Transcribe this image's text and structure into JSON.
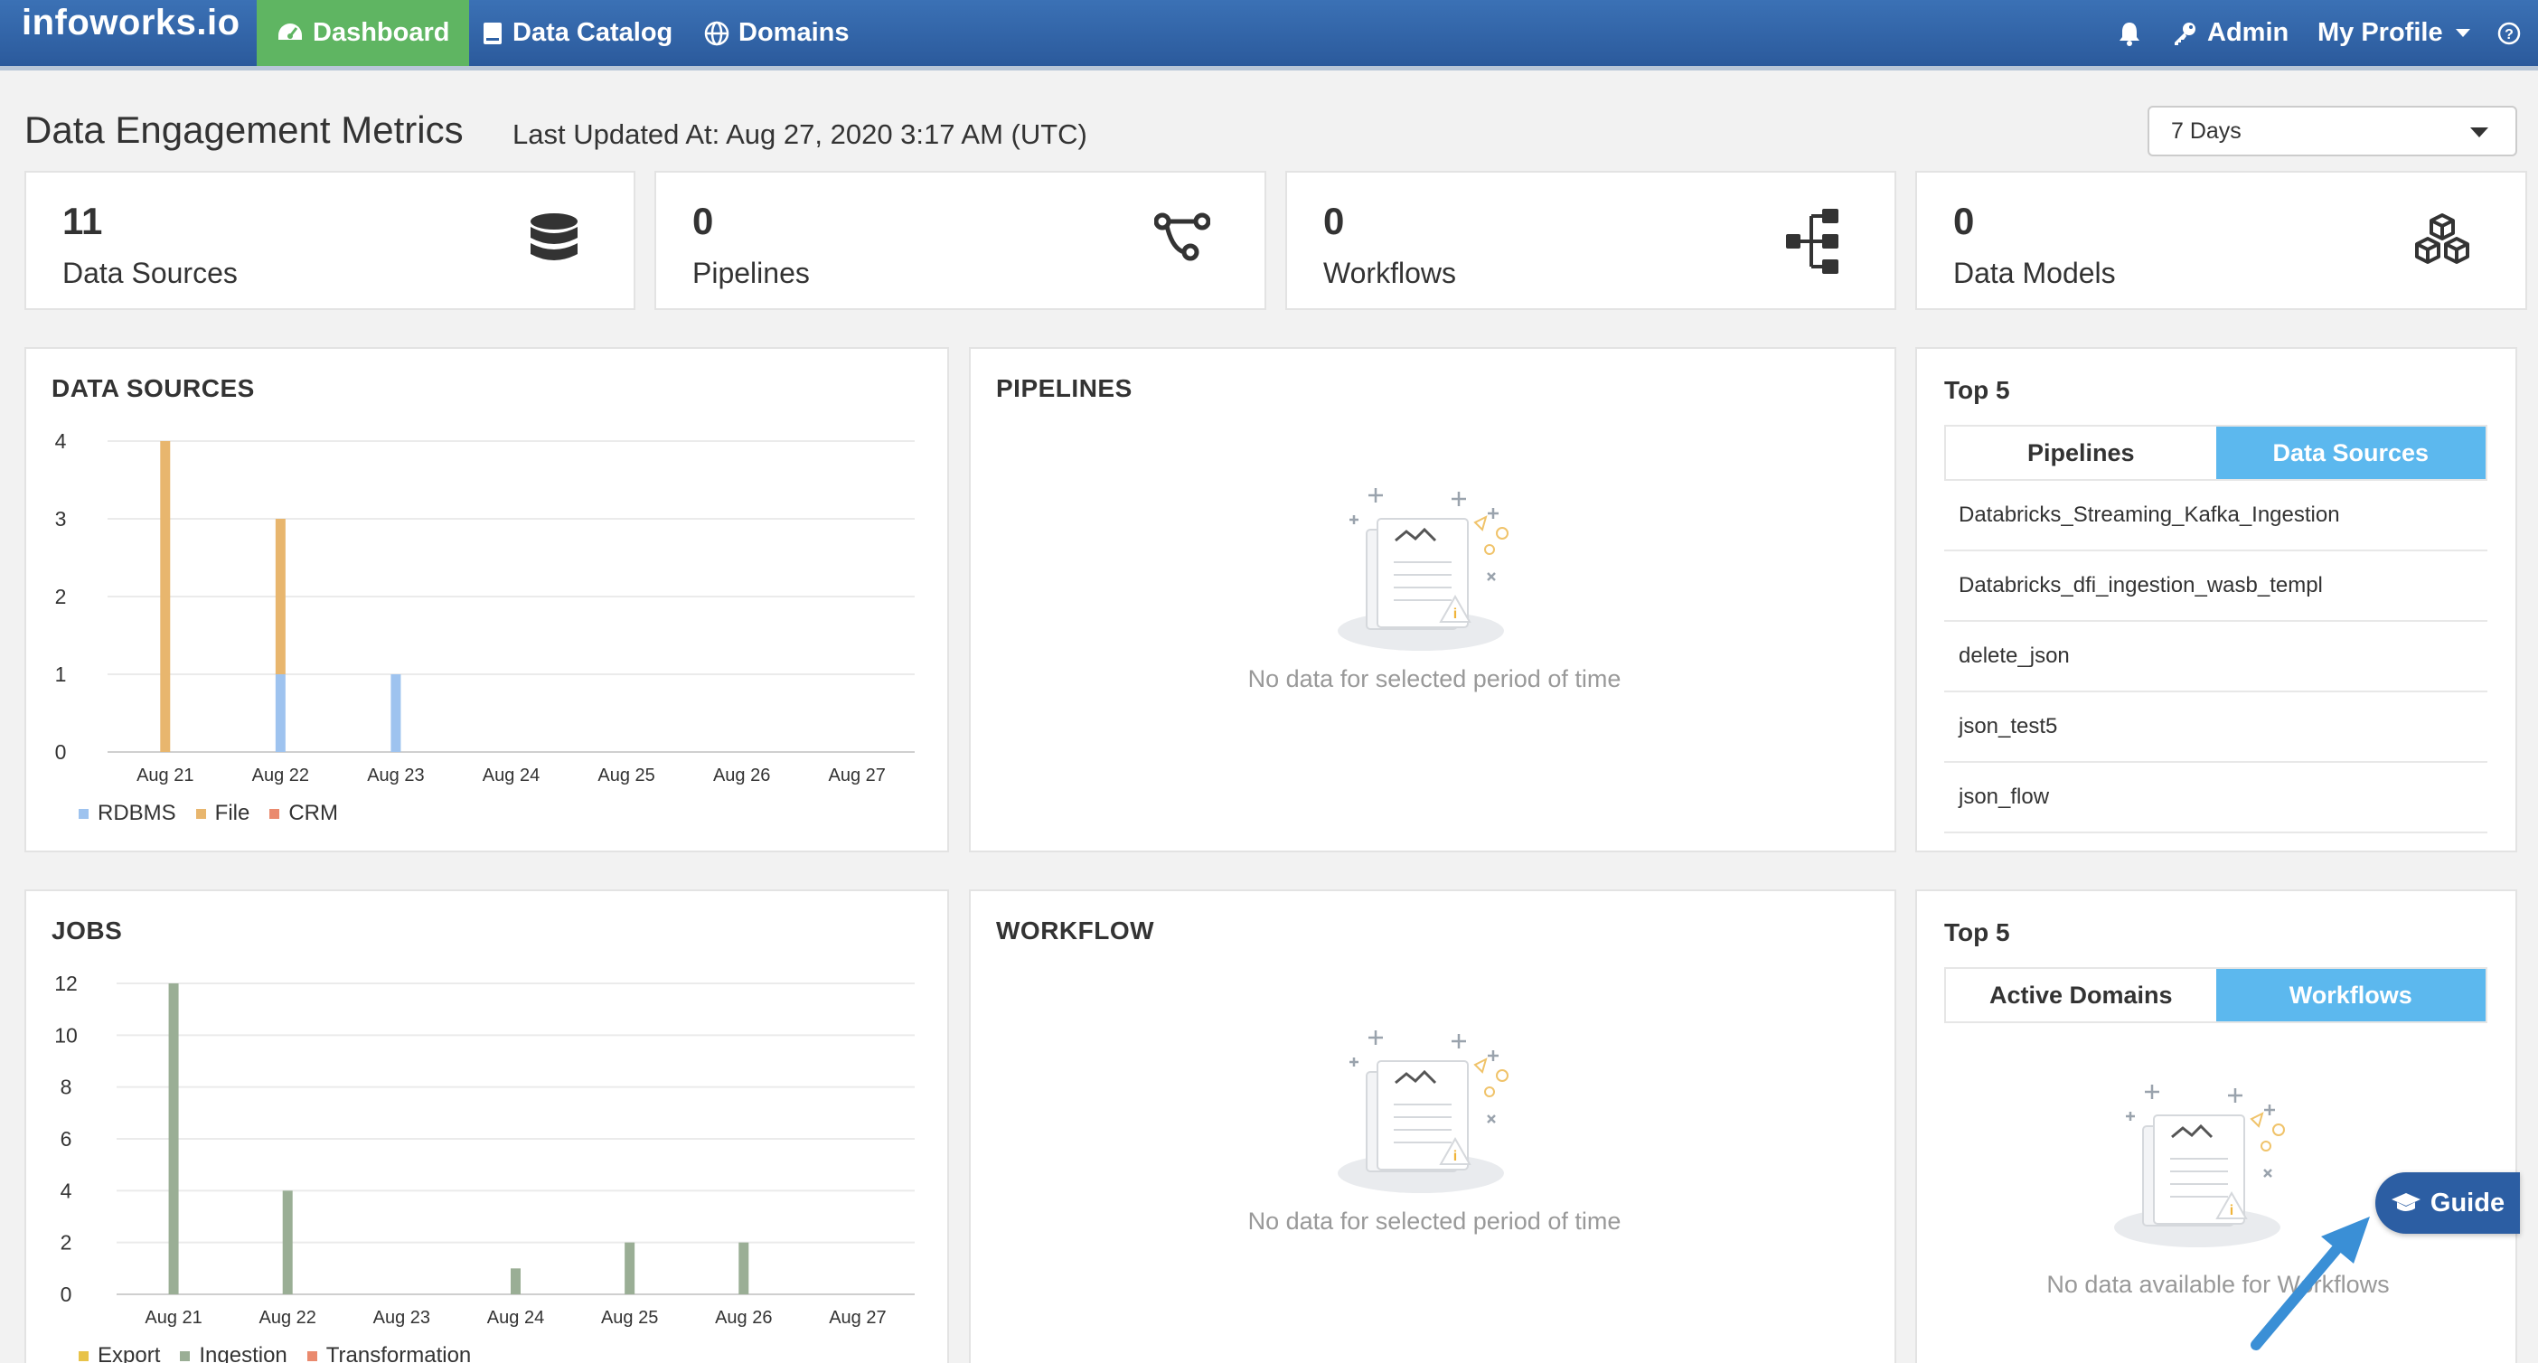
{
  "navbar": {
    "brand": "infoworks.io",
    "items": [
      {
        "label": "Dashboard",
        "icon": "dashboard-icon",
        "active": true
      },
      {
        "label": "Data Catalog",
        "icon": "book-icon",
        "active": false
      },
      {
        "label": "Domains",
        "icon": "globe-icon",
        "active": false
      }
    ],
    "notifications_icon": "bell-icon",
    "admin_label": "Admin",
    "profile_label": "My Profile",
    "help_icon": "help-icon"
  },
  "header": {
    "title": "Data Engagement Metrics",
    "last_updated": "Last Updated At: Aug 27, 2020 3:17 AM (UTC)",
    "period": "7 Days"
  },
  "stats": [
    {
      "value": "11",
      "label": "Data Sources",
      "icon": "database-icon"
    },
    {
      "value": "0",
      "label": "Pipelines",
      "icon": "pipeline-icon"
    },
    {
      "value": "0",
      "label": "Workflows",
      "icon": "workflow-icon"
    },
    {
      "value": "0",
      "label": "Data Models",
      "icon": "cubes-icon"
    }
  ],
  "panels": {
    "data_sources_title": "DATA SOURCES",
    "pipelines_title": "PIPELINES",
    "jobs_title": "JOBS",
    "workflow_title": "WORKFLOW",
    "no_data_text": "No data for selected period of time",
    "top5_title": "Top 5"
  },
  "top5_pipelines": {
    "tabs": [
      {
        "label": "Pipelines",
        "active": false
      },
      {
        "label": "Data Sources",
        "active": true
      }
    ],
    "items": [
      "Databricks_Streaming_Kafka_Ingestion",
      "Databricks_dfi_ingestion_wasb_templ",
      "delete_json",
      "json_test5",
      "json_flow"
    ]
  },
  "top5_domains": {
    "tabs": [
      {
        "label": "Active Domains",
        "active": false
      },
      {
        "label": "Workflows",
        "active": true
      }
    ],
    "empty_text": "No data available for Workflows"
  },
  "guide": {
    "label": "Guide",
    "icon": "graduation-cap-icon"
  },
  "chart_data": [
    {
      "type": "bar",
      "stacked": true,
      "categories": [
        "Aug 21",
        "Aug 22",
        "Aug 23",
        "Aug 24",
        "Aug 25",
        "Aug 26",
        "Aug 27"
      ],
      "series": [
        {
          "name": "RDBMS",
          "color": "#9ec3ef",
          "values": [
            0,
            1,
            1,
            0,
            0,
            0,
            0
          ]
        },
        {
          "name": "File",
          "color": "#e8b66e",
          "values": [
            4,
            2,
            0,
            0,
            0,
            0,
            0
          ]
        },
        {
          "name": "CRM",
          "color": "#ea8a6e",
          "values": [
            0,
            0,
            0,
            0,
            0,
            0,
            0
          ]
        }
      ],
      "ylim": [
        0,
        4
      ],
      "yticks": [
        0,
        1,
        2,
        3,
        4
      ],
      "grid": true,
      "legend": "bottom-left"
    },
    {
      "type": "bar",
      "stacked": true,
      "categories": [
        "Aug 21",
        "Aug 22",
        "Aug 23",
        "Aug 24",
        "Aug 25",
        "Aug 26",
        "Aug 27"
      ],
      "series": [
        {
          "name": "Export",
          "color": "#e8c34a",
          "values": [
            0,
            0,
            0,
            0,
            0,
            0,
            0
          ]
        },
        {
          "name": "Ingestion",
          "color": "#9aae95",
          "values": [
            12,
            4,
            0,
            1,
            2,
            2,
            0
          ]
        },
        {
          "name": "Transformation",
          "color": "#ea8a6e",
          "values": [
            0,
            0,
            0,
            0,
            0,
            0,
            0
          ]
        }
      ],
      "ylim": [
        0,
        12
      ],
      "yticks": [
        0,
        2,
        4,
        6,
        8,
        10,
        12
      ],
      "grid": true,
      "legend": "bottom-left"
    }
  ]
}
